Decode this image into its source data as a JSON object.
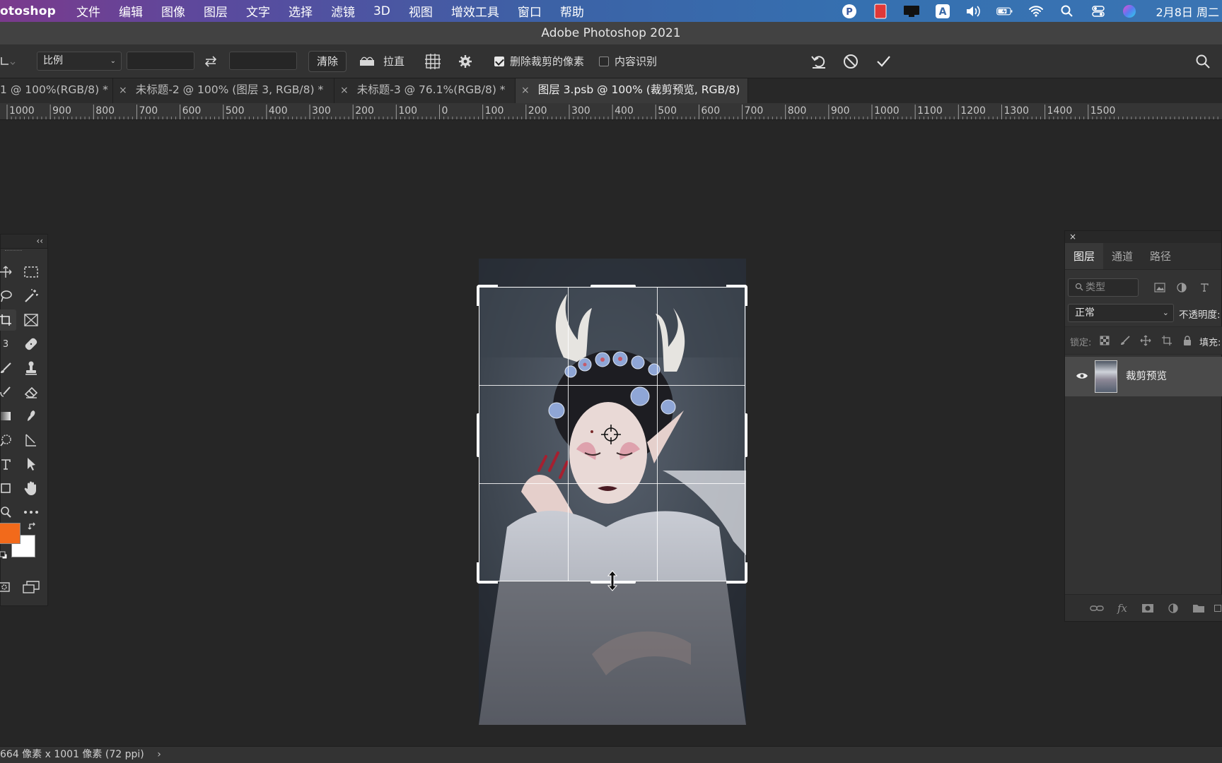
{
  "menubar": {
    "app_name": "otoshop",
    "items": [
      "文件",
      "编辑",
      "图像",
      "图层",
      "文字",
      "选择",
      "滤镜",
      "3D",
      "视图",
      "增效工具",
      "窗口",
      "帮助"
    ],
    "status_icons": [
      "input-method-icon",
      "record-icon",
      "screen-icon",
      "keyboard-a-icon",
      "volume-icon",
      "battery-icon",
      "wifi-icon",
      "search-icon",
      "control-center-icon",
      "siri-icon"
    ],
    "date": "2月8日 周二"
  },
  "window": {
    "title": "Adobe Photoshop 2021"
  },
  "options": {
    "ratio_select": "比例",
    "width_value": "",
    "height_value": "",
    "clear_label": "清除",
    "straighten_label": "拉直",
    "delete_cropped_label": "删除裁剪的像素",
    "delete_cropped_checked": true,
    "content_aware_label": "内容识别",
    "content_aware_checked": false
  },
  "tabs": [
    {
      "label": "@ 100%(RGB/8) *",
      "prefix": "1",
      "active": false
    },
    {
      "label": "未标题-2 @ 100% (图层 3, RGB/8) *",
      "active": false
    },
    {
      "label": "未标题-3 @ 76.1%(RGB/8) *",
      "active": false
    },
    {
      "label": "图层 3.psb @ 100% (裁剪预览, RGB/8)",
      "active": true
    }
  ],
  "ruler": {
    "labels": [
      "1000",
      "900",
      "800",
      "700",
      "600",
      "500",
      "400",
      "300",
      "200",
      "100",
      "0",
      "100",
      "200",
      "300",
      "400",
      "500",
      "600",
      "700",
      "800",
      "900",
      "1000",
      "1100",
      "1200",
      "1300",
      "1400",
      "1500"
    ]
  },
  "layers_panel": {
    "close": "×",
    "tabs": [
      "图层",
      "通道",
      "路径"
    ],
    "filter_placeholder": "类型",
    "blend_mode": "正常",
    "opacity_label": "不透明度:",
    "lock_label": "锁定:",
    "fill_label": "填充:",
    "layer_name": "裁剪预览"
  },
  "status": {
    "text": "664 像素 x 1001 像素 (72 ppi)",
    "arrow": "›"
  },
  "colors": {
    "foreground": "#f26a1b",
    "background": "#ffffff",
    "accent": "#3a74b3"
  }
}
